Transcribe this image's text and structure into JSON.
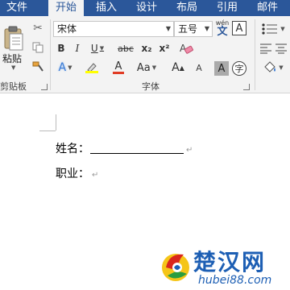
{
  "tabs": [
    {
      "label": "文件"
    },
    {
      "label": "开始"
    },
    {
      "label": "插入"
    },
    {
      "label": "设计"
    },
    {
      "label": "布局"
    },
    {
      "label": "引用"
    },
    {
      "label": "邮件"
    }
  ],
  "ribbon": {
    "clipboard": {
      "paste_label": "粘贴",
      "group_label": "剪贴板"
    },
    "font": {
      "font_name": "宋体",
      "font_size": "五号",
      "phonetic_label": "wén",
      "bold": "B",
      "italic": "I",
      "underline": "U",
      "strikethrough": "abc",
      "subscript": "x₂",
      "superscript": "x²",
      "case_label": "Aa",
      "bordered_a": "A",
      "shaded_a": "A",
      "text_effects_a": "A",
      "font_color_a": "A",
      "group_label": "字体"
    },
    "paragraph": {
      "group_label": ""
    }
  },
  "document": {
    "line1": {
      "label": "姓名：",
      "mark": "↵"
    },
    "line2": {
      "label": "职业：",
      "mark": "↵"
    }
  },
  "watermark": {
    "text": "楚汉网",
    "url": "hubei88.com"
  },
  "colors": {
    "tab_bar": "#2b579a",
    "ribbon_bg": "#f3f3f3",
    "highlight_yellow": "#ffff00",
    "font_red": "#e03b24",
    "watermark_blue": "#1d5fb4"
  }
}
